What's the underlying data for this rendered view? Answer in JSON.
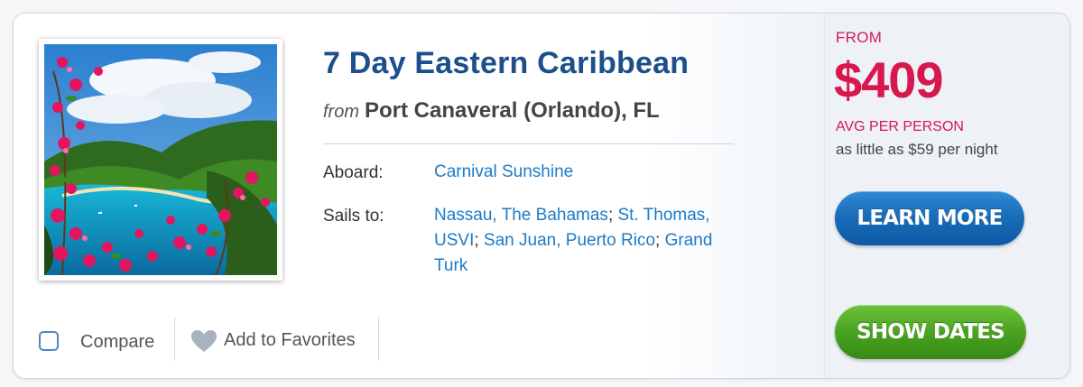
{
  "cruise": {
    "title": "7 Day Eastern Caribbean",
    "from_word": "from",
    "departure_port": "Port Canaveral (Orlando), FL",
    "aboard_label": "Aboard:",
    "ship": "Carnival Sunshine",
    "sails_to_label": "Sails to:",
    "ports": [
      "Nassau, The Bahamas",
      "St. Thomas, USVI",
      "San Juan, Puerto Rico",
      "Grand Turk"
    ],
    "port_separator": ";"
  },
  "pricing": {
    "from_label": "FROM",
    "price": "$409",
    "avg_label": "AVG PER PERSON",
    "per_night": "as little as $59 per night"
  },
  "actions": {
    "compare_label": "Compare",
    "favorites_label": "Add to Favorites",
    "learn_more_label": "LEARN MORE",
    "show_dates_label": "SHOW DATES"
  },
  "colors": {
    "title": "#1c4f8c",
    "price": "#d8174f",
    "link": "#1d7bc6",
    "learn_more_button": "#1a6dba",
    "show_dates_button": "#4aa321"
  },
  "icons": {
    "checkbox": "checkbox-unchecked-icon",
    "favorite": "heart-icon"
  }
}
